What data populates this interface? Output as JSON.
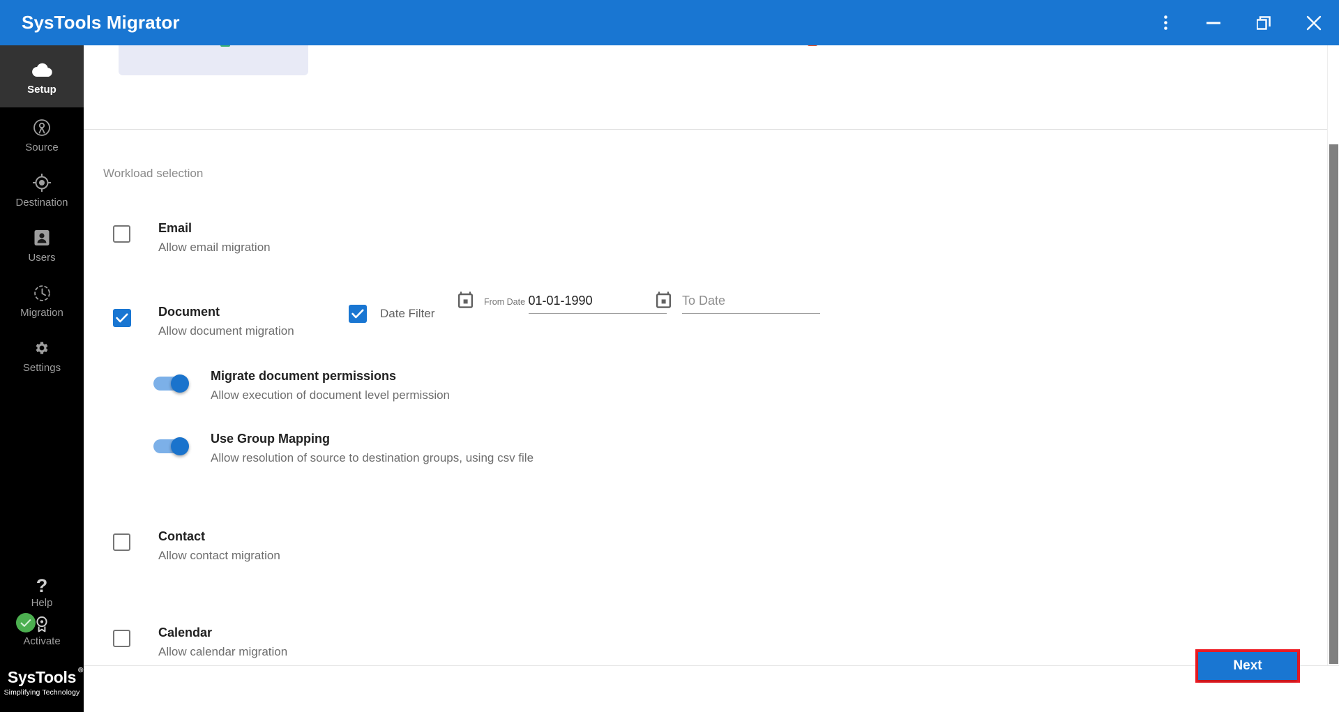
{
  "window": {
    "title": "SysTools Migrator",
    "controls": [
      {
        "name": "more-options",
        "glyph": "kebab-menu-icon"
      },
      {
        "name": "minimize",
        "glyph": "minimize-icon"
      },
      {
        "name": "restore",
        "glyph": "restore-icon"
      },
      {
        "name": "close",
        "glyph": "close-icon"
      }
    ],
    "accent_color": "#1976d2"
  },
  "sidebar": {
    "items": [
      {
        "label": "Setup",
        "icon": "cloud-icon",
        "active": true
      },
      {
        "label": "Source",
        "icon": "source-icon",
        "active": false
      },
      {
        "label": "Destination",
        "icon": "target-icon",
        "active": false
      },
      {
        "label": "Users",
        "icon": "users-icon",
        "active": false
      },
      {
        "label": "Migration",
        "icon": "clock-icon",
        "active": false
      },
      {
        "label": "Settings",
        "icon": "gear-icon",
        "active": false
      }
    ],
    "help": {
      "label": "Help",
      "icon": "question-mark-icon"
    },
    "activate": {
      "label": "Activate",
      "icon": "award-icon",
      "badge": "check-icon",
      "badge_color": "#4caf50"
    },
    "brand": {
      "name": "SysTools",
      "registered": "®",
      "tagline": "Simplifying Technology"
    }
  },
  "main": {
    "section_label": "Workload selection",
    "workloads": [
      {
        "id": "email",
        "title": "Email",
        "subtitle": "Allow email migration",
        "checked": false
      },
      {
        "id": "document",
        "title": "Document",
        "subtitle": "Allow document migration",
        "checked": true
      },
      {
        "id": "contact",
        "title": "Contact",
        "subtitle": "Allow contact migration",
        "checked": false
      },
      {
        "id": "calendar",
        "title": "Calendar",
        "subtitle": "Allow calendar migration",
        "checked": false
      }
    ],
    "date_filter": {
      "label": "Date Filter",
      "checked": true,
      "from": {
        "caption": "From Date",
        "value": "01-01-1990",
        "placeholder": "From Date"
      },
      "to": {
        "caption": "",
        "value": "",
        "placeholder": "To Date"
      }
    },
    "sub_options": [
      {
        "id": "migrate-document-permissions",
        "title": "Migrate document permissions",
        "subtitle": "Allow execution of document level permission",
        "enabled": true
      },
      {
        "id": "use-group-mapping",
        "title": "Use Group Mapping",
        "subtitle": "Allow resolution of source to destination groups, using csv file",
        "enabled": true
      }
    ]
  },
  "footer": {
    "next_label": "Next",
    "highlight_color": "#ed1c24"
  }
}
